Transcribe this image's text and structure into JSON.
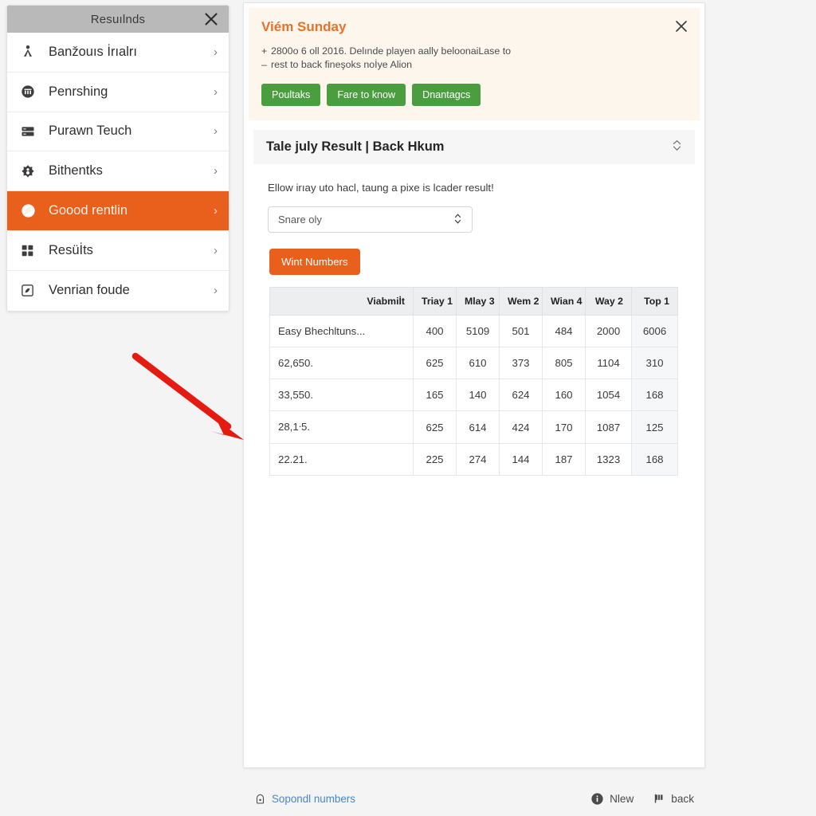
{
  "sidebar": {
    "title": "Resuılnds",
    "close_icon": "close-icon",
    "items": [
      {
        "label": "Banžouıs İrıalrı",
        "icon": "person-icon",
        "chevron": "›",
        "active": false
      },
      {
        "label": "Penrshing",
        "icon": "bank-circle-icon",
        "chevron": "›",
        "active": false
      },
      {
        "label": "Purawn Teuch",
        "icon": "server-rows-icon",
        "chevron": "›",
        "active": false
      },
      {
        "label": "Bithentks",
        "icon": "settings-circle-icon",
        "chevron": "›",
        "active": false
      },
      {
        "label": "Goood rentlin",
        "icon": "leaf-ball-icon",
        "chevron": "›",
        "active": true
      },
      {
        "label": "Resüİts",
        "icon": "grid-squares-icon",
        "chevron": "›",
        "active": false
      },
      {
        "label": "Venrian foude",
        "icon": "boxed-shape-icon",
        "chevron": "›",
        "active": false
      }
    ]
  },
  "notice": {
    "title": "Viém Sunday",
    "close_icon": "close-icon",
    "lines": [
      {
        "bullet": "+",
        "text": "2800o 6 oll 2016. Delınde playen aally beloonaiLase to"
      },
      {
        "bullet": "–",
        "text": "rest to back fineşoks noİye Alion"
      }
    ],
    "buttons": [
      {
        "label": "Poultaks"
      },
      {
        "label": "Fare to know"
      },
      {
        "label": "Dnantagcs"
      }
    ]
  },
  "section": {
    "header_title": "Tale july Result | Back Hkum",
    "sort_icon": "chevron-updown-icon",
    "description": "Ellow irıay uto hacl, taung a pixe is lcader result!",
    "select": {
      "value": "Snare oly",
      "caret_icon": "updown-caret-icon"
    },
    "action_button": "Wint Numbers"
  },
  "table": {
    "columns": [
      "",
      "Viabmiİt",
      "Triay 1",
      "Mlay 3",
      "Wem 2",
      "Wian 4",
      "Way 2",
      "Top 1"
    ],
    "rows": [
      {
        "name": "Easy Bhechltuns...",
        "values": [
          "400",
          "5109",
          "501",
          "484",
          "2000",
          "6006"
        ]
      },
      {
        "name": "62,650.",
        "values": [
          "625",
          "610",
          "373",
          "805",
          "1104",
          "310"
        ]
      },
      {
        "name": "33,550.",
        "values": [
          "165",
          "140",
          "624",
          "160",
          "1054",
          "168"
        ]
      },
      {
        "name": "28,1ᐧ5.",
        "values": [
          "625",
          "614",
          "424",
          "170",
          "1087",
          "125"
        ]
      },
      {
        "name": "22.21.",
        "values": [
          "225",
          "274",
          "144",
          "187",
          "1323",
          "168"
        ]
      }
    ]
  },
  "footer": {
    "left": {
      "label": "Sopondl numbers",
      "icon": "lock-icon"
    },
    "right": [
      {
        "label": "Nlew",
        "icon": "info-circle-icon"
      },
      {
        "label": "back",
        "icon": "flag-icon"
      }
    ]
  },
  "colors": {
    "accent_orange": "#e8601c",
    "notice_bg": "#fdf6ec",
    "notice_title": "#e8712a",
    "green_button": "#4a9e3f",
    "link_blue": "#4a86c5",
    "sidebar_header": "#b9b9b9",
    "annotation_red": "#e51b12",
    "page_bg": "#f4f4f4"
  },
  "annotation": {
    "arrow": "red-pointer-arrow"
  }
}
